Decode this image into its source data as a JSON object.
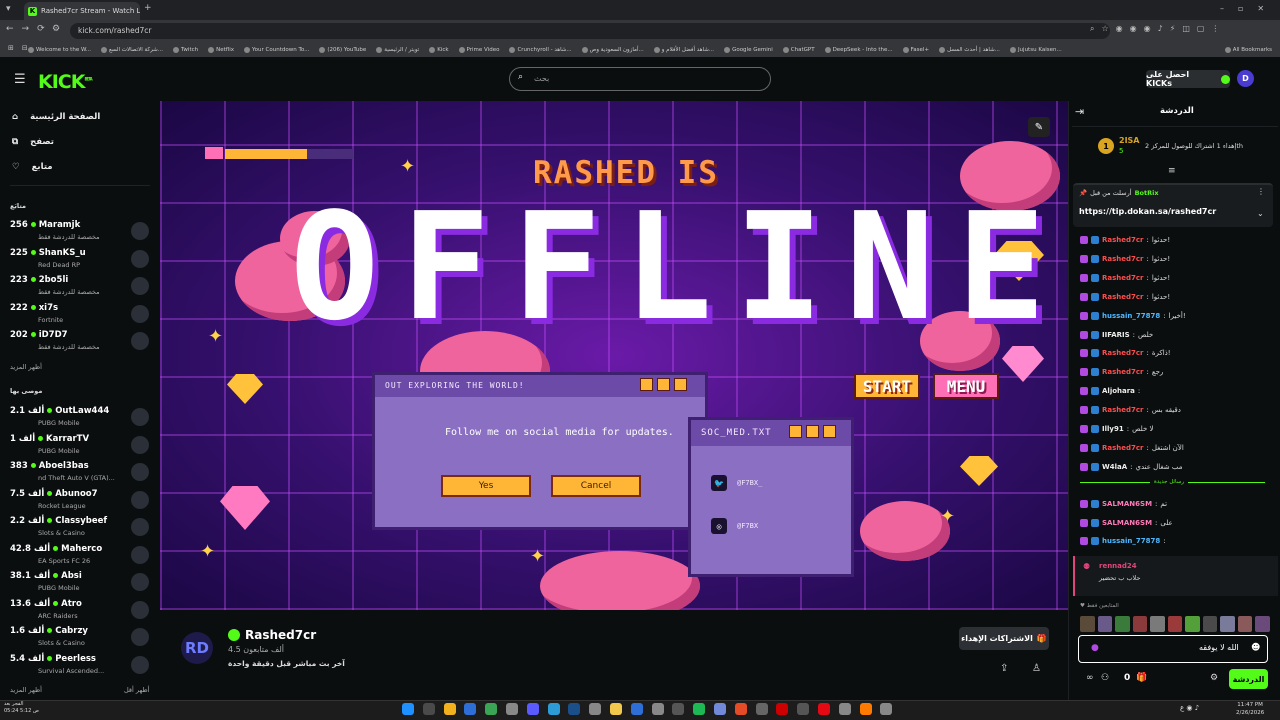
{
  "browser": {
    "tab_title": "Rashed7cr Stream - Watch Live",
    "url": "kick.com/rashed7cr",
    "bookmarks": [
      "Welcome to the W...",
      "شركة الاتصالات السع...",
      "Twitch",
      "Netflix",
      "Your Countdown To...",
      "(206) YouTube",
      "تويتر / الرئيسية",
      "Kick",
      "Prime Video",
      "Crunchyroll - شاهد...",
      "أمازون السعودية وص...",
      "شاهد أفضل الأفلام و...",
      "Google Gemini",
      "ChatGPT",
      "DeepSeek - Into the...",
      "Fasel+",
      "شاهد | أحدث المسل...",
      "Jujutsu Kaisen...",
      "All Bookmarks"
    ]
  },
  "header": {
    "logo": "KICK",
    "logo_badge": "BETA",
    "search_placeholder": "بحث",
    "get_kicks": "احصل على KICKs"
  },
  "sidebar": {
    "nav": [
      {
        "label": "الصفحة الرئيسية",
        "icon": "home-icon"
      },
      {
        "label": "تصفح",
        "icon": "browse-icon"
      },
      {
        "label": "متابع",
        "icon": "heart-icon"
      }
    ],
    "following_title": "متابَع",
    "following": [
      {
        "count": "256",
        "name": "Maramjk",
        "sub": "مخصصة للدردشة فقط"
      },
      {
        "count": "225",
        "name": "ShanKS_u",
        "sub": "Red Dead RP"
      },
      {
        "count": "223",
        "name": "2bo5li",
        "sub": "مخصصة للدردشة فقط"
      },
      {
        "count": "222",
        "name": "xi7s",
        "sub": "Fortnite"
      },
      {
        "count": "202",
        "name": "iD7D7",
        "sub": "مخصصة للدردشة فقط"
      }
    ],
    "show_more": "أظهر المزيد",
    "recommended_title": "موصى بها",
    "recommended": [
      {
        "count": "2.1 ألف",
        "name": "OutLaw444",
        "sub": "PUBG Mobile"
      },
      {
        "count": "1 ألف",
        "name": "KarrarTV",
        "sub": "PUBG Mobile"
      },
      {
        "count": "383",
        "name": "Aboel3bas",
        "sub": "nd Theft Auto V (GTA)..."
      },
      {
        "count": "7.5 ألف",
        "name": "Abunoo7",
        "sub": "Rocket League"
      },
      {
        "count": "2.2 ألف",
        "name": "Classybeef",
        "sub": "Slots & Casino"
      },
      {
        "count": "42.8 ألف",
        "name": "Maherco",
        "sub": "EA Sports FC 26"
      },
      {
        "count": "38.1 ألف",
        "name": "Absi",
        "sub": "PUBG Mobile"
      },
      {
        "count": "13.6 ألف",
        "name": "Atro",
        "sub": "ARC Raiders"
      },
      {
        "count": "1.6 ألف",
        "name": "Cabrzy",
        "sub": "Slots & Casino"
      },
      {
        "count": "5.4 ألف",
        "name": "Peerless",
        "sub": "Survival Ascended..."
      }
    ],
    "show_more_2": "أظهر المزيد",
    "show_less": "أظهر أقل"
  },
  "player": {
    "headline": "RASHED IS",
    "offline": "OFFLINE",
    "dialog1_title": "OUT EXPLORING THE WORLD!",
    "dialog1_line1": "Follow me on social media",
    "dialog1_line2": "for updates.",
    "yes": "Yes",
    "cancel": "Cancel",
    "dialog2_title": "SOC_MED.TXT",
    "twitter": "@F7BX_",
    "instagram": "@F7BX",
    "start": "START",
    "menu": "MENU"
  },
  "channel": {
    "name": "Rashed7cr",
    "followers": "4.5 ألف متابعون",
    "last_live": "آخر بث مباشر قبل دقيقة واحدة",
    "subs_button": "الاشتراكات الإهداء"
  },
  "chat": {
    "title": "الدردشة",
    "leader_name": "2ISA",
    "leader_count": "5",
    "leader_note": "إهداء 1 اشتراك للوصول للمركز 2",
    "leader_suffix": "th",
    "pinned_by": "أرسلت من قبل",
    "pinned_user": "BotRix",
    "pinned_link": "https://tip.dokan.sa/rashed7cr",
    "messages": [
      {
        "user": "Rashed7cr",
        "text": "حدثوا!",
        "color": "#ff4d4d"
      },
      {
        "user": "Rashed7cr",
        "text": "حدثوا!",
        "color": "#ff4d4d"
      },
      {
        "user": "Rashed7cr",
        "text": "حدثوا!",
        "color": "#ff4d4d"
      },
      {
        "user": "Rashed7cr",
        "text": "حدثوا!",
        "color": "#ff4d4d"
      },
      {
        "user": "hussain_77878",
        "text": "أخيرا!",
        "color": "#4db8ff"
      },
      {
        "user": "IIFARIS",
        "text": "خلص",
        "color": "#eeeeee"
      },
      {
        "user": "Rashed7cr",
        "text": "ذاكرة!",
        "color": "#ff4d4d"
      },
      {
        "user": "Rashed7cr",
        "text": "رجع",
        "color": "#ff4d4d"
      },
      {
        "user": "Aljohara",
        "text": "",
        "color": "#eeeeee"
      },
      {
        "user": "Rashed7cr",
        "text": "دقيقه بس",
        "color": "#ff4d4d"
      },
      {
        "user": "Illy91",
        "text": "لا خلص",
        "color": "#eeeeee"
      },
      {
        "user": "Rashed7cr",
        "text": "الآن اشتغل",
        "color": "#ff4d4d"
      },
      {
        "user": "W4laA",
        "text": "مب شغال عندي",
        "color": "#eeeeee"
      }
    ],
    "new_messages": "رسائل جديدة",
    "messages2": [
      {
        "user": "SALMAN6SM",
        "text": "تم",
        "color": "#ff7ab8"
      },
      {
        "user": "SALMAN6SM",
        "text": "على",
        "color": "#ff7ab8"
      },
      {
        "user": "hussain_77878",
        "text": "",
        "color": "#4db8ff"
      }
    ],
    "reply_user": "rennad24",
    "reply_text": "حلاب ب تحضير",
    "emote_label": "المتابعين فقط",
    "input_text": "الله لا يوفقه",
    "kicks_count": "0",
    "send": "الدردشة"
  },
  "taskbar": {
    "time": "11:47 PM",
    "date": "2/26/2026",
    "left_line1": "الفجر",
    "left_line2": "ص 5:12",
    "left_line3": "بعد",
    "left_line4": "05:24"
  },
  "colors": {
    "kick_green": "#53fc18",
    "bg": "#0b0e0f"
  }
}
